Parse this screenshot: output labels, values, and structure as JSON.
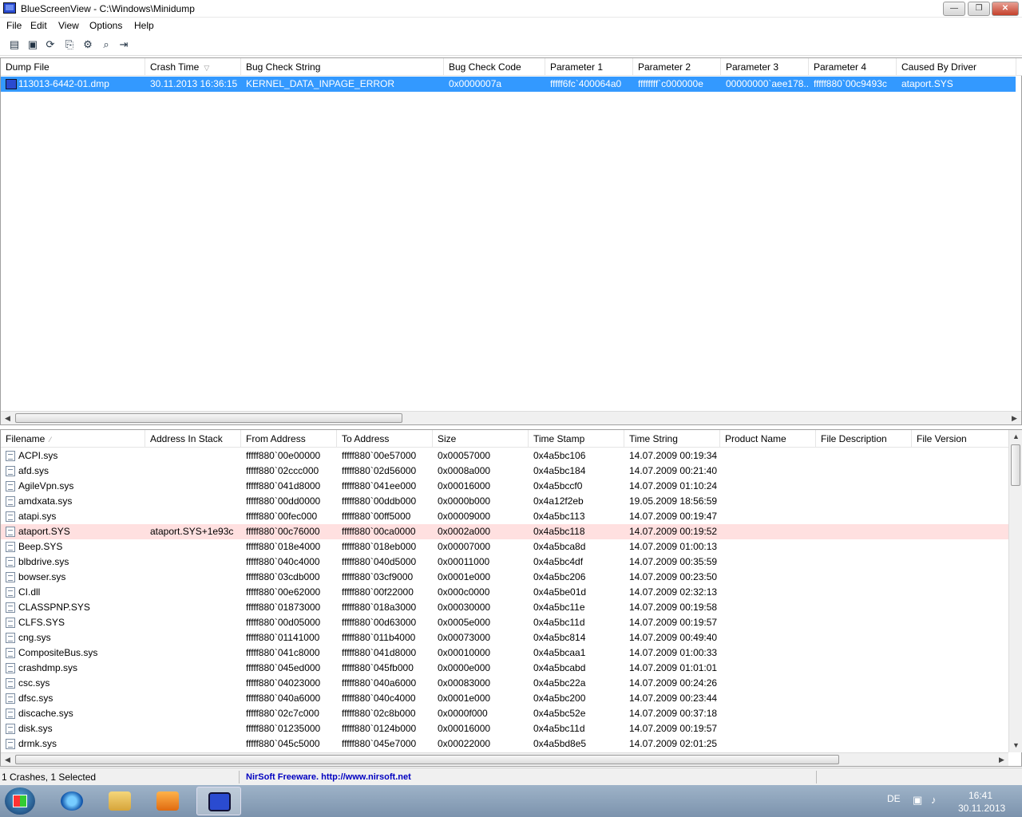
{
  "window": {
    "title": "BlueScreenView  -  C:\\Windows\\Minidump",
    "buttons": {
      "minimize": "—",
      "maximize": "❐",
      "close": "✕"
    }
  },
  "menu": [
    "File",
    "Edit",
    "View",
    "Options",
    "Help"
  ],
  "toolbar": [
    {
      "icon": "properties-icon",
      "glyph": "▤"
    },
    {
      "icon": "save-icon",
      "glyph": "▣"
    },
    {
      "icon": "refresh-icon",
      "glyph": "⟳"
    },
    {
      "icon": "copy-icon",
      "glyph": "⎘"
    },
    {
      "icon": "options-icon",
      "glyph": "⚙"
    },
    {
      "icon": "find-icon",
      "glyph": "⌕"
    },
    {
      "icon": "exit-icon",
      "glyph": "⇥"
    }
  ],
  "top_table": {
    "columns": [
      "Dump File",
      "Crash Time",
      "Bug Check String",
      "Bug Check Code",
      "Parameter 1",
      "Parameter 2",
      "Parameter 3",
      "Parameter 4",
      "Caused By Driver"
    ],
    "sort_column": "Crash Time",
    "sort_glyph": "▽",
    "rows": [
      [
        "113013-6442-01.dmp",
        "30.11.2013 16:36:15",
        "KERNEL_DATA_INPAGE_ERROR",
        "0x0000007a",
        "fffff6fc`400064a0",
        "ffffffff`c000000e",
        "00000000`aee178...",
        "fffff880`00c9493c",
        "ataport.SYS"
      ]
    ]
  },
  "bottom_table": {
    "columns": [
      "Filename",
      "Address In Stack",
      "From Address",
      "To Address",
      "Size",
      "Time Stamp",
      "Time String",
      "Product Name",
      "File Description",
      "File Version"
    ],
    "sort_column": "Filename",
    "sort_glyph": "⁄",
    "highlighted_row": 5,
    "rows": [
      [
        "ACPI.sys",
        "",
        "fffff880`00e00000",
        "fffff880`00e57000",
        "0x00057000",
        "0x4a5bc106",
        "14.07.2009 00:19:34"
      ],
      [
        "afd.sys",
        "",
        "fffff880`02ccc000",
        "fffff880`02d56000",
        "0x0008a000",
        "0x4a5bc184",
        "14.07.2009 00:21:40"
      ],
      [
        "AgileVpn.sys",
        "",
        "fffff880`041d8000",
        "fffff880`041ee000",
        "0x00016000",
        "0x4a5bccf0",
        "14.07.2009 01:10:24"
      ],
      [
        "amdxata.sys",
        "",
        "fffff880`00dd0000",
        "fffff880`00ddb000",
        "0x0000b000",
        "0x4a12f2eb",
        "19.05.2009 18:56:59"
      ],
      [
        "atapi.sys",
        "",
        "fffff880`00fec000",
        "fffff880`00ff5000",
        "0x00009000",
        "0x4a5bc113",
        "14.07.2009 00:19:47"
      ],
      [
        "ataport.SYS",
        "ataport.SYS+1e93c",
        "fffff880`00c76000",
        "fffff880`00ca0000",
        "0x0002a000",
        "0x4a5bc118",
        "14.07.2009 00:19:52"
      ],
      [
        "Beep.SYS",
        "",
        "fffff880`018e4000",
        "fffff880`018eb000",
        "0x00007000",
        "0x4a5bca8d",
        "14.07.2009 01:00:13"
      ],
      [
        "blbdrive.sys",
        "",
        "fffff880`040c4000",
        "fffff880`040d5000",
        "0x00011000",
        "0x4a5bc4df",
        "14.07.2009 00:35:59"
      ],
      [
        "bowser.sys",
        "",
        "fffff880`03cdb000",
        "fffff880`03cf9000",
        "0x0001e000",
        "0x4a5bc206",
        "14.07.2009 00:23:50"
      ],
      [
        "CI.dll",
        "",
        "fffff880`00e62000",
        "fffff880`00f22000",
        "0x000c0000",
        "0x4a5be01d",
        "14.07.2009 02:32:13"
      ],
      [
        "CLASSPNP.SYS",
        "",
        "fffff880`01873000",
        "fffff880`018a3000",
        "0x00030000",
        "0x4a5bc11e",
        "14.07.2009 00:19:58"
      ],
      [
        "CLFS.SYS",
        "",
        "fffff880`00d05000",
        "fffff880`00d63000",
        "0x0005e000",
        "0x4a5bc11d",
        "14.07.2009 00:19:57"
      ],
      [
        "cng.sys",
        "",
        "fffff880`01141000",
        "fffff880`011b4000",
        "0x00073000",
        "0x4a5bc814",
        "14.07.2009 00:49:40"
      ],
      [
        "CompositeBus.sys",
        "",
        "fffff880`041c8000",
        "fffff880`041d8000",
        "0x00010000",
        "0x4a5bcaa1",
        "14.07.2009 01:00:33"
      ],
      [
        "crashdmp.sys",
        "",
        "fffff880`045ed000",
        "fffff880`045fb000",
        "0x0000e000",
        "0x4a5bcabd",
        "14.07.2009 01:01:01"
      ],
      [
        "csc.sys",
        "",
        "fffff880`04023000",
        "fffff880`040a6000",
        "0x00083000",
        "0x4a5bc22a",
        "14.07.2009 00:24:26"
      ],
      [
        "dfsc.sys",
        "",
        "fffff880`040a6000",
        "fffff880`040c4000",
        "0x0001e000",
        "0x4a5bc200",
        "14.07.2009 00:23:44"
      ],
      [
        "discache.sys",
        "",
        "fffff880`02c7c000",
        "fffff880`02c8b000",
        "0x0000f000",
        "0x4a5bc52e",
        "14.07.2009 00:37:18"
      ],
      [
        "disk.sys",
        "",
        "fffff880`01235000",
        "fffff880`0124b000",
        "0x00016000",
        "0x4a5bc11d",
        "14.07.2009 00:19:57"
      ],
      [
        "drmk.sys",
        "",
        "fffff880`045c5000",
        "fffff880`045e7000",
        "0x00022000",
        "0x4a5bd8e5",
        "14.07.2009 02:01:25"
      ]
    ]
  },
  "status": {
    "crashes": "1 Crashes, 1 Selected",
    "link": "NirSoft Freeware.  http://www.nirsoft.net"
  },
  "taskbar": {
    "lang": "DE",
    "time": "16:41",
    "date": "30.11.2013"
  },
  "colors": {
    "selection": "#3399ff",
    "highlight": "#ffe0e0",
    "link": "#0000c0"
  }
}
